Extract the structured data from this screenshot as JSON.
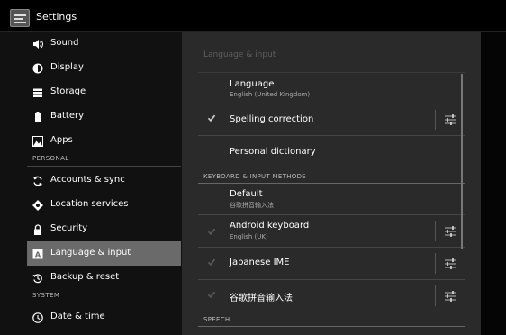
{
  "action_bar": {
    "title": "Settings",
    "icon": "settings-app-icon"
  },
  "sidebar": {
    "sections": [
      {
        "items": [
          {
            "label": "Sound",
            "icon": "speaker-icon",
            "selected": false
          },
          {
            "label": "Display",
            "icon": "brightness-icon",
            "selected": false
          },
          {
            "label": "Storage",
            "icon": "storage-icon",
            "selected": false
          },
          {
            "label": "Battery",
            "icon": "battery-icon",
            "selected": false
          },
          {
            "label": "Apps",
            "icon": "apps-icon",
            "selected": false
          }
        ]
      },
      {
        "header": "PERSONAL",
        "items": [
          {
            "label": "Accounts & sync",
            "icon": "sync-icon",
            "selected": false
          },
          {
            "label": "Location services",
            "icon": "location-icon",
            "selected": false
          },
          {
            "label": "Security",
            "icon": "lock-icon",
            "selected": false
          },
          {
            "label": "Language & input",
            "icon": "language-icon",
            "selected": true
          },
          {
            "label": "Backup & reset",
            "icon": "backup-icon",
            "selected": false
          }
        ]
      },
      {
        "header": "SYSTEM",
        "items": [
          {
            "label": "Date & time",
            "icon": "clock-icon",
            "selected": false
          }
        ]
      }
    ]
  },
  "panel": {
    "title": "Language & input",
    "language": {
      "title": "Language",
      "summary": "English (United Kingdom)"
    },
    "spelling": {
      "title": "Spelling correction",
      "checked": true
    },
    "dictionary": {
      "title": "Personal dictionary"
    },
    "keyboard_header": "KEYBOARD & INPUT METHODS",
    "default_ime": {
      "title": "Default",
      "summary": "谷歌拼音输入法"
    },
    "android_keyboard": {
      "title": "Android keyboard",
      "summary": "English (UK)",
      "checked": true
    },
    "japanese_ime": {
      "title": "Japanese IME",
      "checked": true
    },
    "pinyin_ime": {
      "title": "谷歌拼音输入法",
      "checked": true
    },
    "speech_header": "SPEECH"
  }
}
